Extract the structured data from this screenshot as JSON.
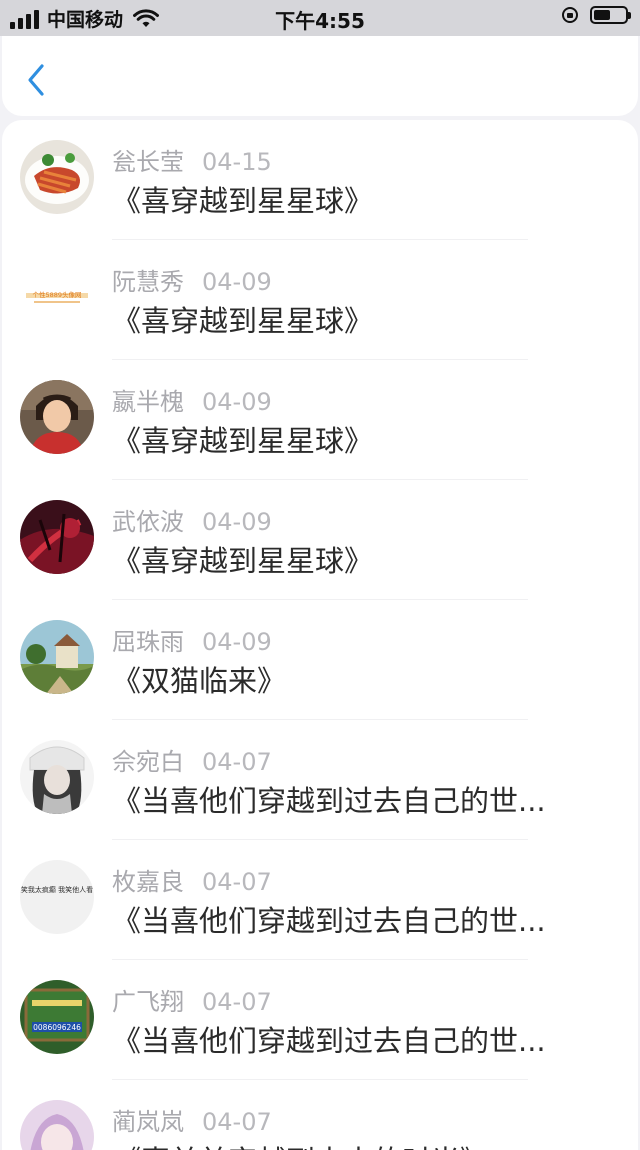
{
  "status_bar": {
    "carrier": "中国移动",
    "time": "下午4:55"
  },
  "nav": {
    "back_icon": "chevron-left-icon",
    "accent_color": "#2f8fe0"
  },
  "comments": [
    {
      "name": "瓮长莹",
      "date": "04-15",
      "title": "《喜穿越到星星球》"
    },
    {
      "name": "阮慧秀",
      "date": "04-09",
      "title": "《喜穿越到星星球》"
    },
    {
      "name": "嬴半槐",
      "date": "04-09",
      "title": "《喜穿越到星星球》"
    },
    {
      "name": "武依波",
      "date": "04-09",
      "title": "《喜穿越到星星球》"
    },
    {
      "name": "屈珠雨",
      "date": "04-09",
      "title": "《双猫临来》"
    },
    {
      "name": "佘宛白",
      "date": "04-07",
      "title": "《当喜他们穿越到过去自己的世..."
    },
    {
      "name": "枚嘉良",
      "date": "04-07",
      "title": "《当喜他们穿越到过去自己的世..."
    },
    {
      "name": "广飞翔",
      "date": "04-07",
      "title": "《当喜他们穿越到过去自己的世..."
    },
    {
      "name": "蔺岚岚",
      "date": "04-07",
      "title": "《喜羊羊穿越到未来的时光》"
    }
  ],
  "avatar_images": {
    "avatar_1": {
      "text": ""
    },
    "avatar_2": {
      "text": "个性5889头像网"
    },
    "avatar_7": {
      "text": "别人笑我太疯癫 我笑他人看不穿"
    },
    "avatar_8": {
      "text": "0086096246"
    }
  }
}
